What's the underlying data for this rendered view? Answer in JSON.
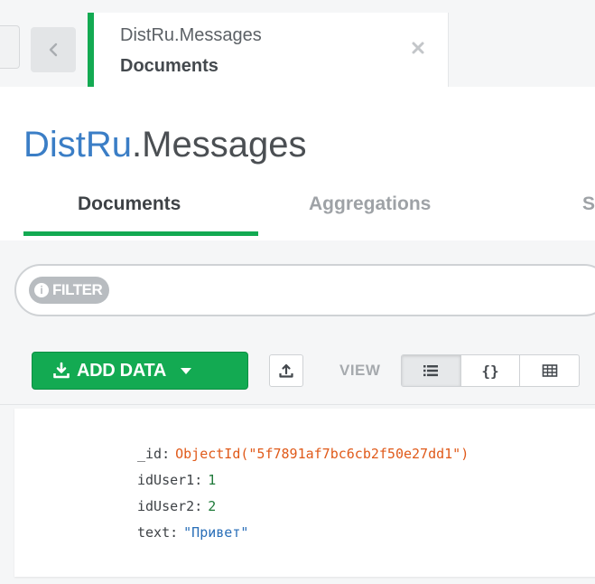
{
  "tab": {
    "namespace": "DistRu.Messages",
    "subtitle": "Documents"
  },
  "header": {
    "database": "DistRu",
    "dot_collection": ".Messages"
  },
  "subtabs": {
    "documents": "Documents",
    "aggregations": "Aggregations",
    "schema": "S"
  },
  "query": {
    "filter_label": "FILTER",
    "filter_info": "i"
  },
  "toolbar": {
    "add_data_label": "ADD DATA",
    "view_label": "VIEW",
    "view_json_glyph": "{}"
  },
  "document": {
    "fields": [
      {
        "key": "_id",
        "value": "ObjectId(\"5f7891af7bc6cb2f50e27dd1\")",
        "type": "objectid"
      },
      {
        "key": "idUser1",
        "value": "1",
        "type": "number"
      },
      {
        "key": "idUser2",
        "value": "2",
        "type": "number"
      },
      {
        "key": "text",
        "value": "\"Привет\"",
        "type": "string"
      }
    ]
  },
  "colors": {
    "accent_green": "#13aa52",
    "db_blue": "#3b7ec6",
    "objectid_orange": "#e05a1a",
    "number_green": "#1f7a3a",
    "string_blue": "#2a6fb8"
  },
  "icons": {
    "back": "chevron-left-icon",
    "close": "close-icon",
    "add_data": "download-icon",
    "add_data_dropdown": "caret-down-icon",
    "export": "upload-icon",
    "list_view": "list-icon",
    "table_view": "table-icon",
    "info": "info-icon"
  }
}
